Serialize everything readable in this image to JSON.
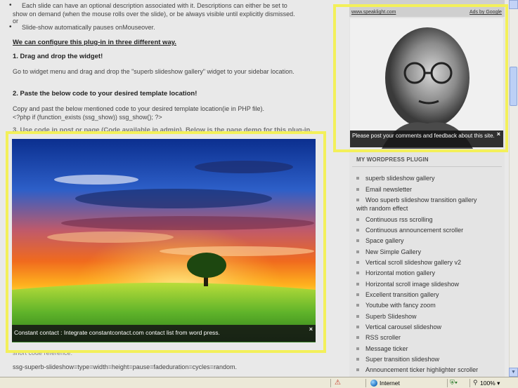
{
  "article": {
    "bullet1_line1": "Each slide can have an optional description associated with it. Descriptions can either be set to",
    "bullet1_line2": "show on demand (when the mouse rolls over the slide), or be always visible until explicitly dismissed.",
    "bullet1_line3": "or",
    "bullet2": "Slide-show automatically pauses onMouseover.",
    "configure_heading": "We can configure this plug-in in three different way.",
    "step1_heading": "1. Drag and drop the widget!",
    "step1_text": "Go to widget menu and drag and drop the \"superb slideshow gallery\" widget to your sidebar location.",
    "step2_heading": "2. Paste the below code to your desired template location!",
    "step2_text1": "Copy and past the below mentioned code to your desired template location(ie in PHP file).",
    "step2_text2": "<?php if (function_exists (ssg_show)) ssg_show(); ?>",
    "step3_heading": "3. Use code in post or page (Code available in admin). Below is the page demo for this plug-in.",
    "shortcode_label": "short code reference:",
    "shortcode": "ssg-superb-slideshow=type=width=height=pause=fadeduration=cycles=random."
  },
  "slideshow": {
    "caption": "Constant contact : Integrate constantcontact.com contact list from word press.",
    "close": "×",
    "highlight_color": "#f3f05a"
  },
  "sidebar": {
    "ad_url": "www.speaklight.com",
    "ad_label": "Ads by Google",
    "gandhi_caption": "Please post your comments and feedback about this site.",
    "gandhi_close": "×",
    "plugin_title": "MY WORDPRESS PLUGIN",
    "plugins": [
      "superb slideshow gallery",
      "Email newsletter",
      "Woo superb slideshow transition gallery",
      "with random effect",
      "Continuous rss scrolling",
      "Continuous announcement scroller",
      "Space gallery",
      "New Simple Gallery",
      "Vertical scroll slideshow gallery v2",
      "Horizontal motion gallery",
      "Horizontal scroll image slideshow",
      "Excellent transition gallery",
      "Youtube with fancy zoom",
      "Superb Slideshow",
      "Vertical carousel slideshow",
      "RSS scroller",
      "Message ticker",
      "Super transition slideshow",
      "Announcement ticker highlighter scroller"
    ]
  },
  "statusbar": {
    "zone": "Internet",
    "zoom": "100%",
    "zoom_arrow": "▾",
    "protect_arrow": "▾"
  },
  "icons": {
    "security": "security-warning-icon",
    "zone": "internet-globe-icon",
    "zoom": "magnifier-icon",
    "protected_mode": "protected-mode-icon"
  }
}
